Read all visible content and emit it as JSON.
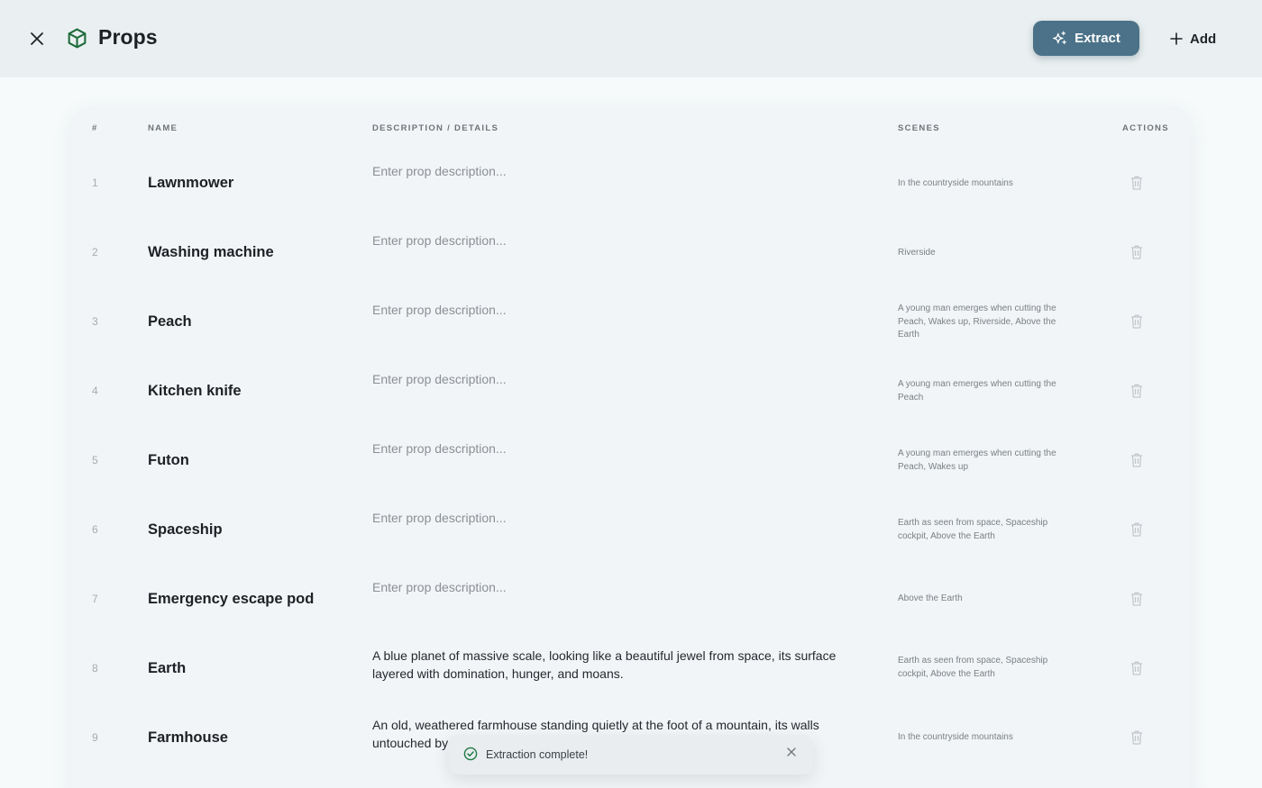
{
  "header": {
    "title": "Props",
    "extract_label": "Extract",
    "add_label": "Add"
  },
  "table": {
    "columns": {
      "num": "#",
      "name": "NAME",
      "description": "DESCRIPTION / DETAILS",
      "scenes": "SCENES",
      "actions": "ACTIONS"
    },
    "rows": [
      {
        "num": "1",
        "name": "Lawnmower",
        "description": "Enter prop description...",
        "scenes": "In the countryside mountains"
      },
      {
        "num": "2",
        "name": "Washing machine",
        "description": "Enter prop description...",
        "scenes": "Riverside"
      },
      {
        "num": "3",
        "name": "Peach",
        "description": "Enter prop description...",
        "scenes": "A young man emerges when cutting the Peach, Wakes up, Riverside, Above the Earth"
      },
      {
        "num": "4",
        "name": "Kitchen knife",
        "description": "Enter prop description...",
        "scenes": "A young man emerges when cutting the Peach"
      },
      {
        "num": "5",
        "name": "Futon",
        "description": "Enter prop description...",
        "scenes": "A young man emerges when cutting the Peach, Wakes up"
      },
      {
        "num": "6",
        "name": "Spaceship",
        "description": "Enter prop description...",
        "scenes": "Earth as seen from space, Spaceship cockpit, Above the Earth"
      },
      {
        "num": "7",
        "name": "Emergency escape pod",
        "description": "Enter prop description...",
        "scenes": "Above the Earth"
      },
      {
        "num": "8",
        "name": "Earth",
        "description": "A blue planet of massive scale, looking like a beautiful jewel from space, its surface layered with domination, hunger, and moans.",
        "scenes": "Earth as seen from space, Spaceship cockpit, Above the Earth"
      },
      {
        "num": "9",
        "name": "Farmhouse",
        "description": "An old, weathered farmhouse standing quietly at the foot of a mountain, its walls untouched by",
        "scenes": "In the countryside mountains"
      }
    ]
  },
  "toast": {
    "message": "Extraction complete!"
  },
  "colors": {
    "accent": "#4b7288",
    "icon_green": "#1f6b3a",
    "topbar_bg": "#eaf0f1",
    "card_bg": "#f2f5f7"
  },
  "icons": {
    "close": "close-icon",
    "title": "box-icon",
    "extract": "sparkle-icon",
    "add": "plus-icon",
    "row_action": "trash-icon",
    "toast": "check-circle-icon",
    "toast_close": "close-icon"
  }
}
